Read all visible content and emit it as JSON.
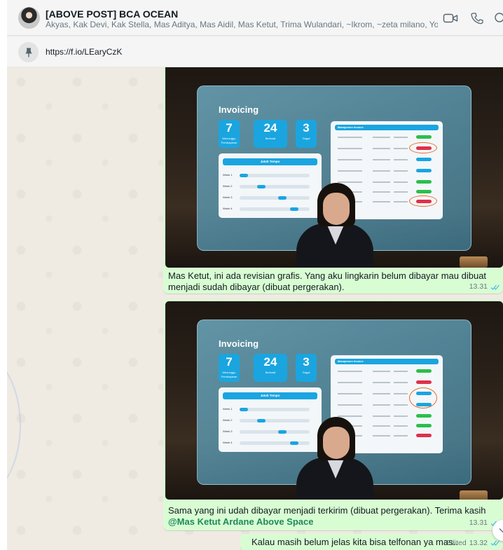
{
  "header": {
    "title": "[ABOVE POST] BCA OCEAN",
    "members": "Akyas, Kak Devi, Kak Stella, Mas Aditya, Mas Aidil, Mas Ketut, Trima Wulandari, ~Ikrom, ~zeta milano, You",
    "icons": [
      "video-call-icon",
      "voice-call-icon",
      "search-icon"
    ]
  },
  "pinned": {
    "icon": "pin-icon",
    "link": "https://f.io/LEaryCzK"
  },
  "invoice_image": {
    "title": "Invoicing",
    "stats": [
      {
        "value": "7",
        "label": "Menunggu Pembayaran"
      },
      {
        "value": "24",
        "label": "Berhasil"
      },
      {
        "value": "3",
        "label": "Gagal"
      }
    ],
    "due_title": "Jatuh Tempo",
    "weeks": [
      "Week 1",
      "Week 2",
      "Week 3",
      "Week 4"
    ],
    "management_title": "Manajemen Invoice"
  },
  "messages": [
    {
      "caption": "Mas Ketut, ini ada revisian grafis. Yang aku lingkarin belum dibayar mau dibuat menjadi sudah dibayar (dibuat pergerakan).",
      "time": "13.31"
    },
    {
      "caption_text": "Sama yang ini udah dibayar menjadi terkirim (dibuat pergerakan). Terima kasih ",
      "mention": "@Mas Ketut Ardane Above Space",
      "time": "13.31"
    },
    {
      "caption": "Kalau masih belum jelas kita bisa telfonan ya mas..",
      "edited": "Edited",
      "time": "13.32"
    }
  ],
  "colors": {
    "bubble_out": "#d9fdd3",
    "chat_bg": "#efeae2",
    "read_ticks": "#53bdeb",
    "mention": "#1d8a5c"
  }
}
